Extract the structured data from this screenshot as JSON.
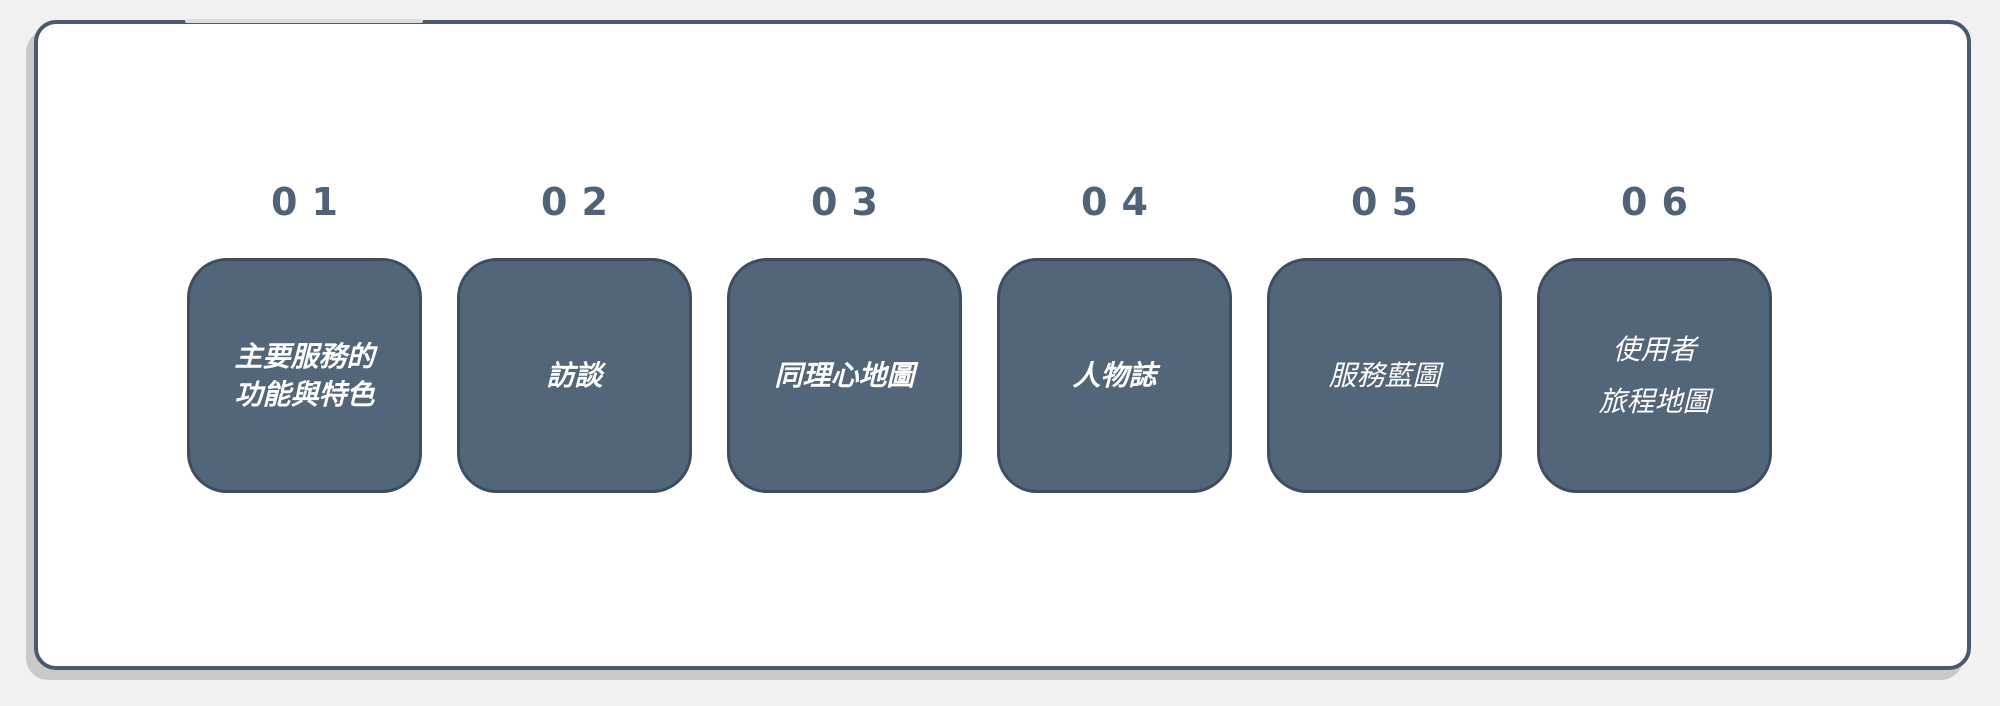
{
  "steps": [
    {
      "number": "01",
      "label": "主要服務的\n功能與特色",
      "style": "sans"
    },
    {
      "number": "02",
      "label": "訪談",
      "style": "sans"
    },
    {
      "number": "03",
      "label": "同理心地圖",
      "style": "sans"
    },
    {
      "number": "04",
      "label": "人物誌",
      "style": "sans"
    },
    {
      "number": "05",
      "label": "服務藍圖",
      "style": "serif"
    },
    {
      "number": "06",
      "label": "使用者\n旅程地圖",
      "style": "serif"
    }
  ],
  "colors": {
    "card_fill": "#526579",
    "card_border": "#3e4c5f",
    "number_text": "#4f6278",
    "panel_border": "#4a5a6e"
  }
}
